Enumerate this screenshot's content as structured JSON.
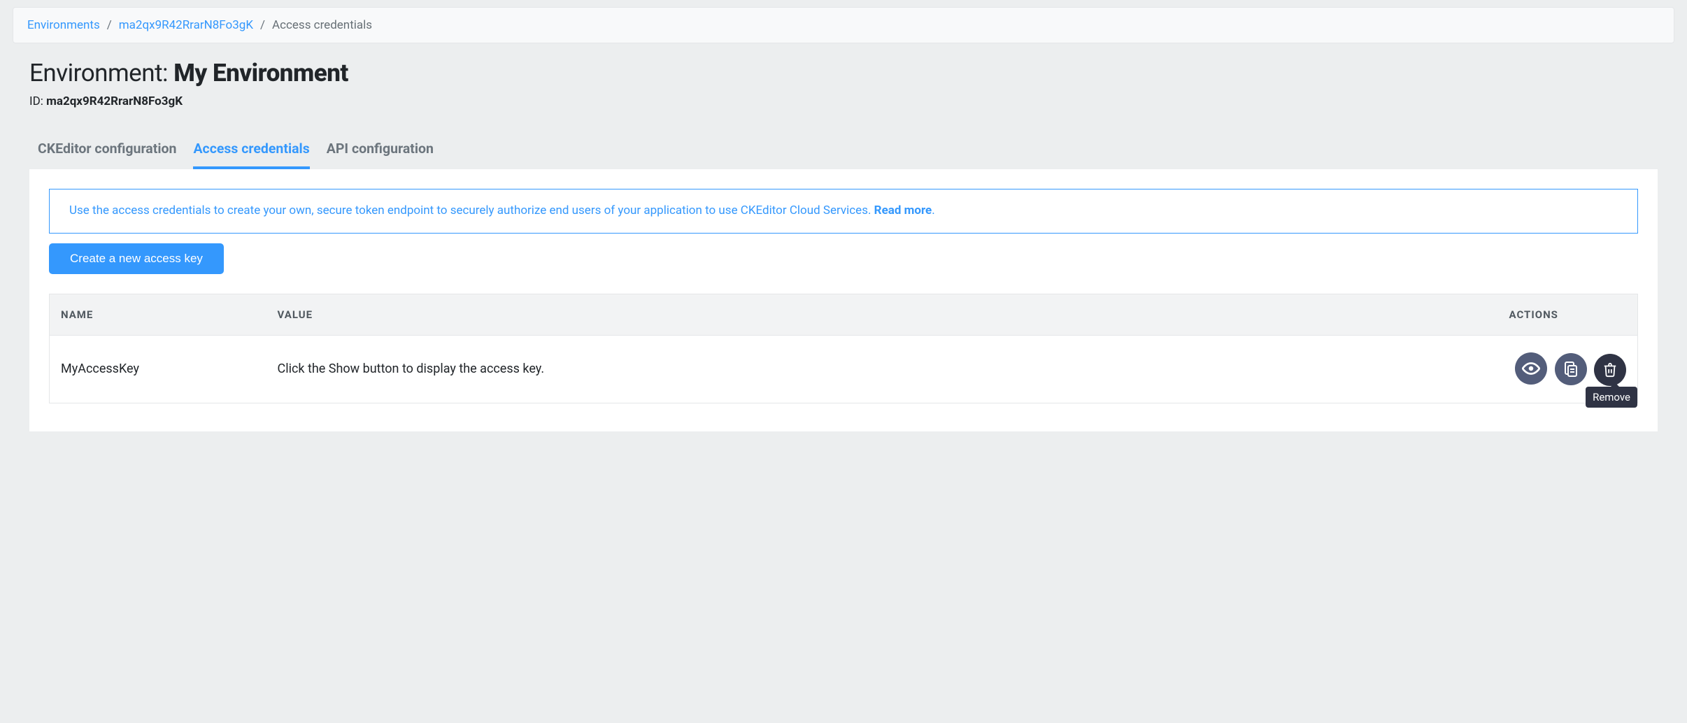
{
  "breadcrumb": {
    "items": [
      {
        "label": "Environments",
        "link": true
      },
      {
        "label": "ma2qx9R42RrarN8Fo3gK",
        "link": true
      },
      {
        "label": "Access credentials",
        "link": false
      }
    ]
  },
  "header": {
    "title_prefix": "Environment: ",
    "title_name": "My Environment",
    "id_label": "ID: ",
    "id_value": "ma2qx9R42RrarN8Fo3gK"
  },
  "tabs": [
    {
      "label": "CKEditor configuration",
      "active": false
    },
    {
      "label": "Access credentials",
      "active": true
    },
    {
      "label": "API configuration",
      "active": false
    }
  ],
  "info": {
    "text": "Use the access credentials to create your own, secure token endpoint to securely authorize end users of your application to use CKEditor Cloud Services. ",
    "link": "Read more",
    "suffix": "."
  },
  "buttons": {
    "create_key": "Create a new access key"
  },
  "table": {
    "headers": {
      "name": "NAME",
      "value": "VALUE",
      "actions": "ACTIONS"
    },
    "rows": [
      {
        "name": "MyAccessKey",
        "value": "Click the Show button to display the access key."
      }
    ]
  },
  "tooltip": {
    "remove": "Remove"
  }
}
